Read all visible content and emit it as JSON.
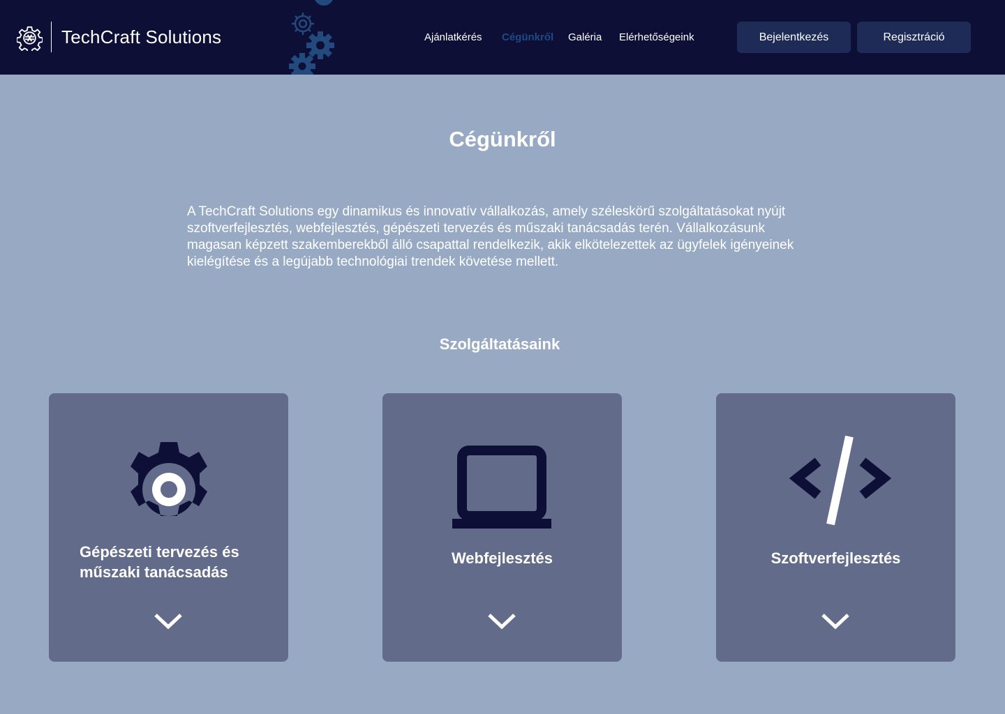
{
  "header": {
    "brand": "TechCraft Solutions",
    "nav": [
      "Ajánlatkérés",
      "Cégünkről",
      "Galéria",
      "Elérhetőségeink"
    ],
    "active_nav": "Cégünkről",
    "login_label": "Bejelentkezés",
    "register_label": "Regisztráció"
  },
  "main": {
    "title": "Cégünkről",
    "intro": "A TechCraft Solutions egy dinamikus és innovatív vállalkozás, amely széleskörű szolgáltatásokat nyújt szoftverfejlesztés, webfejlesztés, gépészeti tervezés és műszaki tanácsadás terén. Vállalkozásunk magasan képzett szakemberekből álló csapattal rendelkezik, akik elkötelezettek az ügyfelek igényeinek kielégítése és a legújabb technológiai trendek követése mellett.",
    "services_title": "Szolgáltatásaink",
    "services": [
      {
        "title": "Gépészeti tervezés és műszaki tanácsadás",
        "icon": "gear-icon"
      },
      {
        "title": "Webfejlesztés",
        "icon": "laptop-icon"
      },
      {
        "title": "Szoftverfejlesztés",
        "icon": "code-icon"
      }
    ]
  },
  "colors": {
    "header_bg": "#0d0f36",
    "page_bg": "#98a9c3",
    "card_bg": "#636b8b",
    "button_bg": "#1e2b56",
    "active_nav": "#1f4a85",
    "icon_dark": "#0d0f36"
  }
}
